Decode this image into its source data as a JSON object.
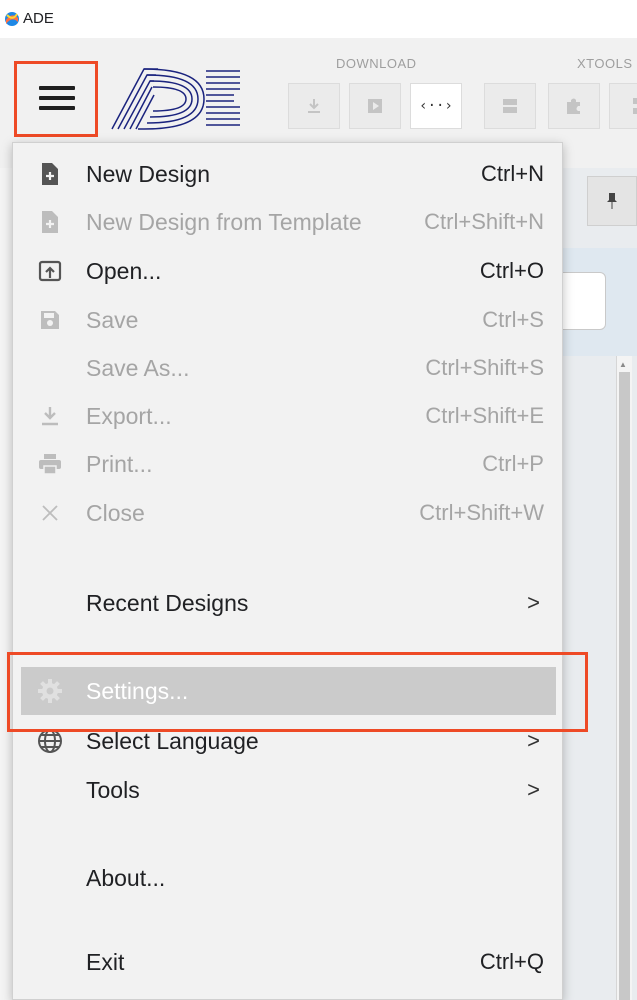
{
  "window": {
    "title": "ADE"
  },
  "toolbar": {
    "groups": [
      {
        "label": "DOWNLOAD"
      },
      {
        "label": "XTOOLS"
      }
    ],
    "code_button_glyph": "‹··›"
  },
  "menu": {
    "items": [
      {
        "label": "New Design",
        "shortcut": "Ctrl+N",
        "icon": "new-file-icon",
        "enabled": true
      },
      {
        "label": "New Design from Template",
        "shortcut": "Ctrl+Shift+N",
        "icon": "new-file-icon",
        "enabled": false
      },
      {
        "label": "Open...",
        "shortcut": "Ctrl+O",
        "icon": "open-icon",
        "enabled": true
      },
      {
        "label": "Save",
        "shortcut": "Ctrl+S",
        "icon": "save-icon",
        "enabled": false
      },
      {
        "label": "Save As...",
        "shortcut": "Ctrl+Shift+S",
        "icon": "",
        "enabled": false
      },
      {
        "label": "Export...",
        "shortcut": "Ctrl+Shift+E",
        "icon": "export-icon",
        "enabled": false
      },
      {
        "label": "Print...",
        "shortcut": "Ctrl+P",
        "icon": "print-icon",
        "enabled": false
      },
      {
        "label": "Close",
        "shortcut": "Ctrl+Shift+W",
        "icon": "close-icon",
        "enabled": false
      },
      {
        "label": "Recent Designs",
        "submenu_arrow": ">",
        "enabled": true
      },
      {
        "label": "Settings...",
        "icon": "gear-icon",
        "enabled": true,
        "highlighted": true
      },
      {
        "label": "Select Language",
        "submenu_arrow": ">",
        "icon": "globe-icon",
        "enabled": true
      },
      {
        "label": "Tools",
        "submenu_arrow": ">",
        "enabled": true
      },
      {
        "label": "About...",
        "enabled": true
      },
      {
        "label": "Exit",
        "shortcut": "Ctrl+Q",
        "enabled": true
      }
    ]
  },
  "colors": {
    "highlight_outline": "#ee4a26",
    "logo_blue": "#1a237e",
    "menu_bg": "#f2f2f2",
    "disabled_text": "#a5a5a5"
  }
}
